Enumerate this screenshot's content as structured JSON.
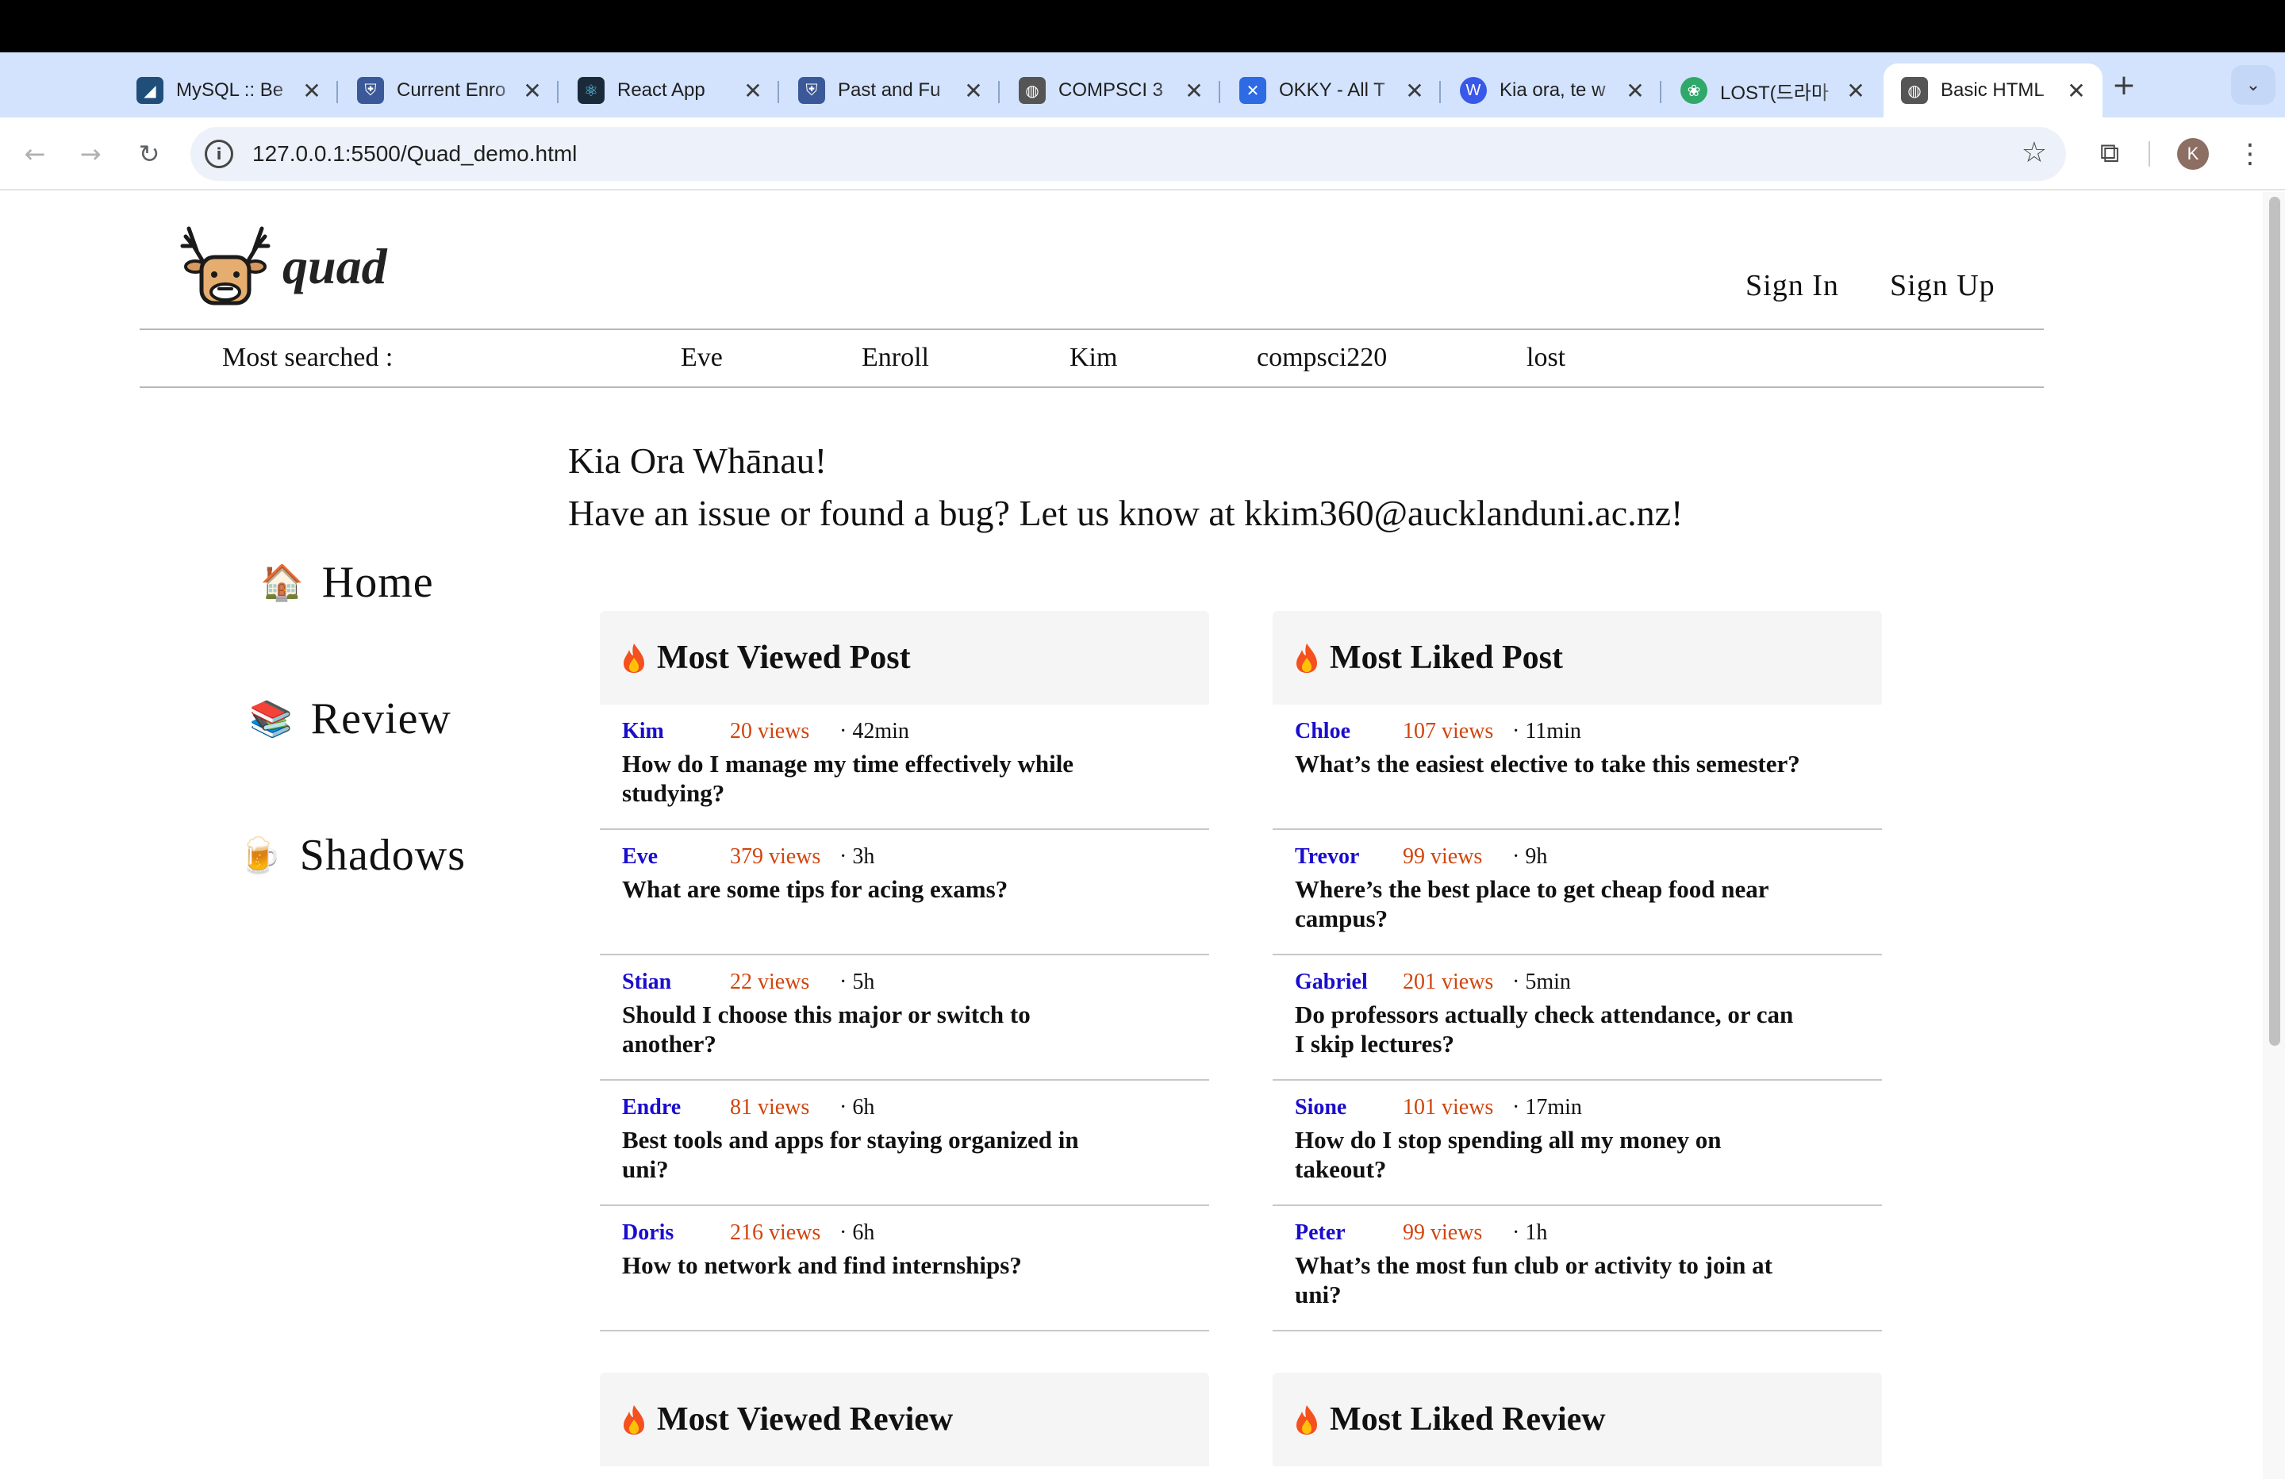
{
  "browser": {
    "tabs": [
      {
        "title": "MySQL :: Be",
        "icon": "mysql-icon",
        "color": "#1f4e79"
      },
      {
        "title": "Current Enro",
        "icon": "shield-icon",
        "color": "#3b5998"
      },
      {
        "title": "React App",
        "icon": "react-icon",
        "color": "#1b2a3a"
      },
      {
        "title": "Past and Fu",
        "icon": "shield-icon",
        "color": "#3b5998"
      },
      {
        "title": "COMPSCI 3",
        "icon": "globe-icon",
        "color": "#555555"
      },
      {
        "title": "OKKY - All T",
        "icon": "okky-icon",
        "color": "#2d6ae3"
      },
      {
        "title": "Kia ora, te w",
        "icon": "wordpress-icon",
        "color": "#3858e9"
      },
      {
        "title": "LOST(드라마",
        "icon": "lost-icon",
        "color": "#2fa86a"
      },
      {
        "title": "Basic HTML",
        "icon": "globe-icon",
        "color": "#555555"
      }
    ],
    "url": "127.0.0.1:5500/Quad_demo.html",
    "avatar_letter": "K"
  },
  "site": {
    "brand": "quad",
    "sign_in": "Sign In",
    "sign_up": "Sign Up",
    "most_searched_label": "Most searched :",
    "most_searched": [
      "Eve",
      "Enroll",
      "Kim",
      "compsci220",
      "lost"
    ],
    "greeting_line1": "Kia Ora Whānau!",
    "greeting_line2": "Have an issue or found a bug? Let us know at kkim360@aucklanduni.ac.nz!",
    "nav": [
      {
        "emoji": "🏠",
        "label": "Home"
      },
      {
        "emoji": "📚",
        "label": "Review"
      },
      {
        "emoji": "🍺",
        "label": "Shadows"
      }
    ]
  },
  "cards": {
    "most_viewed_post": {
      "title": "Most Viewed Post",
      "posts": [
        {
          "author": "Kim",
          "views": "20 views",
          "time": "· 42min",
          "title": "How do I manage my time effectively while studying?"
        },
        {
          "author": "Eve",
          "views": "379 views",
          "time": "· 3h",
          "title": "What are some tips for acing exams?"
        },
        {
          "author": "Stian",
          "views": "22 views",
          "time": "· 5h",
          "title": "Should I choose this major or switch to another?"
        },
        {
          "author": "Endre",
          "views": "81 views",
          "time": "· 6h",
          "title": "Best tools and apps for staying organized in uni?"
        },
        {
          "author": "Doris",
          "views": "216 views",
          "time": "· 6h",
          "title": "How to network and find internships?"
        }
      ]
    },
    "most_liked_post": {
      "title": "Most Liked Post",
      "posts": [
        {
          "author": "Chloe",
          "views": "107 views",
          "time": "· 11min",
          "title": "What’s the easiest elective to take this semester?"
        },
        {
          "author": "Trevor",
          "views": "99 views",
          "time": "· 9h",
          "title": "Where’s the best place to get cheap food near campus?"
        },
        {
          "author": "Gabriel",
          "views": "201 views",
          "time": "· 5min",
          "title": "Do professors actually check attendance, or can I skip lectures?"
        },
        {
          "author": "Sione",
          "views": "101 views",
          "time": "· 17min",
          "title": "How do I stop spending all my money on takeout?"
        },
        {
          "author": "Peter",
          "views": "99 views",
          "time": "· 1h",
          "title": "What’s the most fun club or activity to join at uni?"
        }
      ]
    },
    "most_viewed_review": {
      "title": "Most Viewed Review"
    },
    "most_liked_review": {
      "title": "Most Liked Review"
    }
  }
}
